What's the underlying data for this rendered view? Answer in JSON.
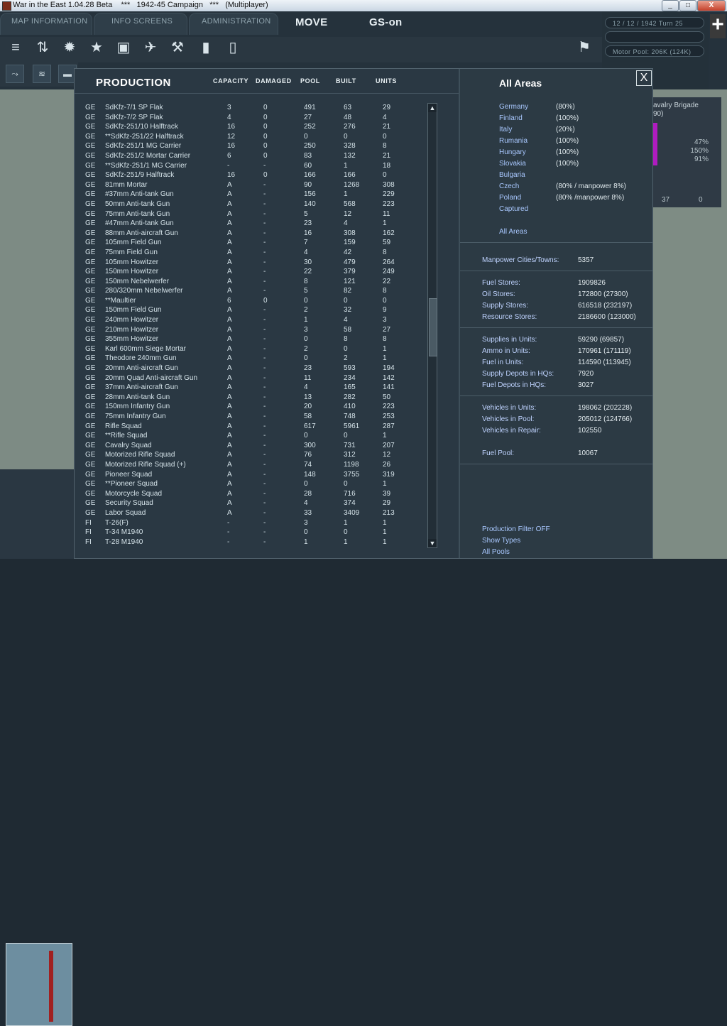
{
  "window": {
    "title": "War in the East 1.04.28 Beta    ***   1942-45 Campaign   ***   (Multiplayer)",
    "buttons": {
      "minimize": "_",
      "maximize": "□",
      "close": "X"
    }
  },
  "topmenu": {
    "map_information": "MAP INFORMATION",
    "info_screens": "INFO SCREENS",
    "administration": "ADMINISTRATION",
    "move": "MOVE",
    "gs_on": "GS-on"
  },
  "status": {
    "date_turn": "12 / 12 / 1942   Turn 25",
    "motor_pool": "Motor Pool:  206K (124K)"
  },
  "unit_card": {
    "name": "avalry Brigade",
    "sub": "90)",
    "pcts": [
      "47%",
      "150%",
      "91%"
    ],
    "bottom": [
      "37",
      "0"
    ]
  },
  "production": {
    "title": "PRODUCTION",
    "headers": {
      "capacity": "CAPACITY",
      "damaged": "DAMAGED",
      "pool": "POOL",
      "built": "BUILT",
      "units": "UNITS"
    },
    "rows": [
      [
        "GE",
        "SdKfz-7/1 SP Flak",
        "3",
        "0",
        "491",
        "63",
        "29"
      ],
      [
        "GE",
        "SdKfz-7/2 SP Flak",
        "4",
        "0",
        "27",
        "48",
        "4"
      ],
      [
        "GE",
        "SdKfz-251/10 Halftrack",
        "16",
        "0",
        "252",
        "276",
        "21"
      ],
      [
        "GE",
        "**SdKfz-251/22 Halftrack",
        "12",
        "0",
        "0",
        "0",
        "0"
      ],
      [
        "GE",
        "SdKfz-251/1 MG Carrier",
        "16",
        "0",
        "250",
        "328",
        "8"
      ],
      [
        "GE",
        "SdKfz-251/2 Mortar Carrier",
        "6",
        "0",
        "83",
        "132",
        "21"
      ],
      [
        "GE",
        "**SdKfz-251/1 MG Carrier",
        "-",
        "-",
        "60",
        "1",
        "18"
      ],
      [
        "GE",
        "SdKfz-251/9 Halftrack",
        "16",
        "0",
        "166",
        "166",
        "0"
      ],
      [
        "GE",
        "81mm Mortar",
        "A",
        "-",
        "90",
        "1268",
        "308"
      ],
      [
        "GE",
        "#37mm Anti-tank Gun",
        "A",
        "-",
        "156",
        "1",
        "229"
      ],
      [
        "GE",
        "50mm Anti-tank Gun",
        "A",
        "-",
        "140",
        "568",
        "223"
      ],
      [
        "GE",
        "75mm Anti-tank Gun",
        "A",
        "-",
        "5",
        "12",
        "11"
      ],
      [
        "GE",
        "#47mm Anti-tank Gun",
        "A",
        "-",
        "23",
        "4",
        "1"
      ],
      [
        "GE",
        "88mm Anti-aircraft Gun",
        "A",
        "-",
        "16",
        "308",
        "162"
      ],
      [
        "GE",
        "105mm Field Gun",
        "A",
        "-",
        "7",
        "159",
        "59"
      ],
      [
        "GE",
        "75mm Field Gun",
        "A",
        "-",
        "4",
        "42",
        "8"
      ],
      [
        "GE",
        "105mm Howitzer",
        "A",
        "-",
        "30",
        "479",
        "264"
      ],
      [
        "GE",
        "150mm Howitzer",
        "A",
        "-",
        "22",
        "379",
        "249"
      ],
      [
        "GE",
        "150mm Nebelwerfer",
        "A",
        "-",
        "8",
        "121",
        "22"
      ],
      [
        "GE",
        "280/320mm Nebelwerfer",
        "A",
        "-",
        "5",
        "82",
        "8"
      ],
      [
        "GE",
        "**Maultier",
        "6",
        "0",
        "0",
        "0",
        "0"
      ],
      [
        "GE",
        "150mm Field Gun",
        "A",
        "-",
        "2",
        "32",
        "9"
      ],
      [
        "GE",
        "240mm Howitzer",
        "A",
        "-",
        "1",
        "4",
        "3"
      ],
      [
        "GE",
        "210mm Howitzer",
        "A",
        "-",
        "3",
        "58",
        "27"
      ],
      [
        "GE",
        "355mm Howitzer",
        "A",
        "-",
        "0",
        "8",
        "8"
      ],
      [
        "GE",
        "Karl 600mm Siege Mortar",
        "A",
        "-",
        "2",
        "0",
        "1"
      ],
      [
        "GE",
        "Theodore 240mm Gun",
        "A",
        "-",
        "0",
        "2",
        "1"
      ],
      [
        "GE",
        "20mm Anti-aircraft Gun",
        "A",
        "-",
        "23",
        "593",
        "194"
      ],
      [
        "GE",
        "20mm Quad Anti-aircraft Gun",
        "A",
        "-",
        "11",
        "234",
        "142"
      ],
      [
        "GE",
        "37mm Anti-aircraft Gun",
        "A",
        "-",
        "4",
        "165",
        "141"
      ],
      [
        "GE",
        "28mm Anti-tank Gun",
        "A",
        "-",
        "13",
        "282",
        "50"
      ],
      [
        "GE",
        "150mm Infantry Gun",
        "A",
        "-",
        "20",
        "410",
        "223"
      ],
      [
        "GE",
        "75mm Infantry Gun",
        "A",
        "-",
        "58",
        "748",
        "253"
      ],
      [
        "GE",
        "Rifle Squad",
        "A",
        "-",
        "617",
        "5961",
        "287"
      ],
      [
        "GE",
        "**Rifle Squad",
        "A",
        "-",
        "0",
        "0",
        "1"
      ],
      [
        "GE",
        "Cavalry Squad",
        "A",
        "-",
        "300",
        "731",
        "207"
      ],
      [
        "GE",
        "Motorized Rifle Squad",
        "A",
        "-",
        "76",
        "312",
        "12"
      ],
      [
        "GE",
        "Motorized Rifle Squad (+)",
        "A",
        "-",
        "74",
        "1198",
        "26"
      ],
      [
        "GE",
        "Pioneer Squad",
        "A",
        "-",
        "148",
        "3755",
        "319"
      ],
      [
        "GE",
        "**Pioneer Squad",
        "A",
        "-",
        "0",
        "0",
        "1"
      ],
      [
        "GE",
        "Motorcycle Squad",
        "A",
        "-",
        "28",
        "716",
        "39"
      ],
      [
        "GE",
        "Security Squad",
        "A",
        "-",
        "4",
        "374",
        "29"
      ],
      [
        "GE",
        "Labor Squad",
        "A",
        "-",
        "33",
        "3409",
        "213"
      ],
      [
        "FI",
        "T-26(F)",
        "-",
        "-",
        "3",
        "1",
        "1"
      ],
      [
        "FI",
        "T-34 M1940",
        "-",
        "-",
        "0",
        "0",
        "1"
      ],
      [
        "FI",
        "T-28 M1940",
        "-",
        "-",
        "1",
        "1",
        "1"
      ]
    ]
  },
  "areas": {
    "title": "All Areas",
    "close": "X",
    "list": [
      {
        "name": "Germany",
        "value": "(80%)"
      },
      {
        "name": "Finland",
        "value": "(100%)"
      },
      {
        "name": "Italy",
        "value": "(20%)"
      },
      {
        "name": "Rumania",
        "value": "(100%)"
      },
      {
        "name": "Hungary",
        "value": "(100%)"
      },
      {
        "name": "Slovakia",
        "value": "(100%)"
      },
      {
        "name": "Bulgaria",
        "value": ""
      },
      {
        "name": "Czech",
        "value": "(80% / manpower 8%)"
      },
      {
        "name": "Poland",
        "value": "(80% /manpower 8%)"
      },
      {
        "name": "Captured",
        "value": ""
      }
    ],
    "all_areas_link": "All Areas"
  },
  "stats": {
    "manpower": {
      "label": "Manpower Cities/Towns:",
      "value": "5357"
    },
    "stores": [
      {
        "label": "Fuel Stores:",
        "value": "1909826"
      },
      {
        "label": "Oil Stores:",
        "value": "172800 (27300)"
      },
      {
        "label": "Supply Stores:",
        "value": "616518 (232197)"
      },
      {
        "label": "Resource Stores:",
        "value": "2186600 (123000)"
      }
    ],
    "units": [
      {
        "label": "Supplies in Units:",
        "value": "59290 (69857)"
      },
      {
        "label": "Ammo in Units:",
        "value": "170961 (171119)"
      },
      {
        "label": "Fuel in Units:",
        "value": "114590 (113945)"
      },
      {
        "label": "Supply Depots in HQs:",
        "value": "7920"
      },
      {
        "label": "Fuel Depots in HQs:",
        "value": "3027"
      }
    ],
    "vehicles": [
      {
        "label": "Vehicles in Units:",
        "value": "198062 (202228)"
      },
      {
        "label": "Vehicles in Pool:",
        "value": "205012 (124766)"
      },
      {
        "label": "Vehicles in Repair:",
        "value": "102550"
      }
    ],
    "fuel_pool": {
      "label": "Fuel Pool:",
      "value": "10067"
    }
  },
  "links": {
    "production_filter": "Production Filter OFF",
    "show_types": "Show Types",
    "all_pools": "All Pools"
  }
}
